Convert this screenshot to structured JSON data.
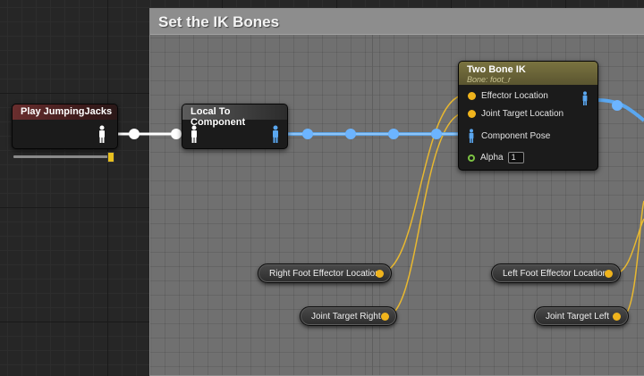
{
  "comment_box": {
    "title": "Set the IK Bones"
  },
  "nodes": {
    "play": {
      "title": "Play JumpingJacks",
      "play_rate": 1.0
    },
    "local_to_component": {
      "title": "Local To Component"
    },
    "two_bone_ik": {
      "title": "Two Bone IK",
      "subtitle": "Bone: foot_r",
      "pins": {
        "effector": "Effector Location",
        "joint_target": "Joint Target Location",
        "component_pose": "Component Pose",
        "alpha": "Alpha"
      },
      "alpha_value": "1"
    }
  },
  "variables": {
    "right_effector": "Right Foot Effector Location",
    "joint_target_right": "Joint Target Right",
    "left_effector": "Left Foot Effector Location",
    "joint_target_left": "Joint Target Left"
  },
  "colors": {
    "pose_wire": "#5aa7f0",
    "vector_wire": "#e8b830",
    "exec_wire": "#ffffff"
  },
  "icons": [
    "person-icon",
    "pose-pin-icon",
    "vector-pin-icon",
    "float-pin-icon"
  ]
}
